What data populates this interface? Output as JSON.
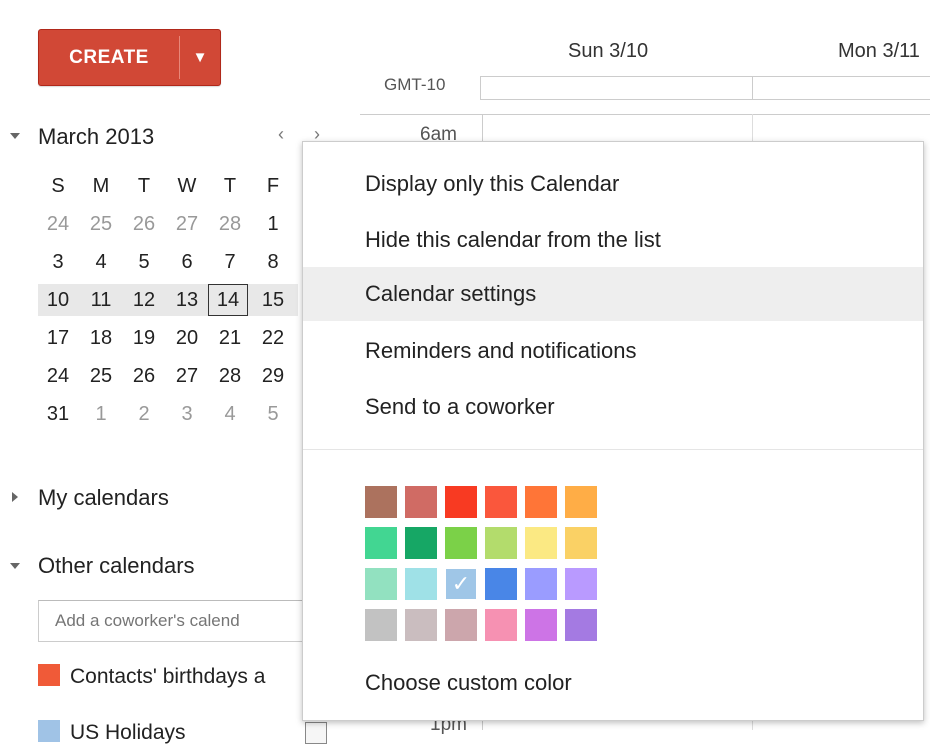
{
  "create": {
    "label": "CREATE",
    "arrow": "▼"
  },
  "grid": {
    "days": [
      "Sun 3/10",
      "Mon 3/11"
    ],
    "timezone": "GMT-10",
    "time_top": "6am",
    "time_bottom": "1pm"
  },
  "mini_calendar": {
    "title": "March 2013",
    "prev": "‹",
    "next": "›",
    "weekdays": [
      "S",
      "M",
      "T",
      "W",
      "T",
      "F"
    ],
    "weeks": [
      [
        "24",
        "25",
        "26",
        "27",
        "28",
        "1"
      ],
      [
        "3",
        "4",
        "5",
        "6",
        "7",
        "8"
      ],
      [
        "10",
        "11",
        "12",
        "13",
        "14",
        "15"
      ],
      [
        "17",
        "18",
        "19",
        "20",
        "21",
        "22"
      ],
      [
        "24",
        "25",
        "26",
        "27",
        "28",
        "29"
      ],
      [
        "31",
        "1",
        "2",
        "3",
        "4",
        "5"
      ]
    ]
  },
  "sidebar": {
    "my_calendars": "My calendars",
    "other_calendars": "Other calendars",
    "add_placeholder": "Add a coworker's calend",
    "items": [
      {
        "label": "Contacts' birthdays a",
        "color": "#f05a38"
      },
      {
        "label": "US Holidays",
        "color": "#a0c3e6"
      }
    ]
  },
  "menu": {
    "items": [
      "Display only this Calendar",
      "Hide this calendar from the list",
      "Calendar settings",
      "Reminders and notifications",
      "Send to a coworker"
    ],
    "hovered": "Calendar settings",
    "colors": [
      [
        "#ac725e",
        "#d06b64",
        "#f83a22",
        "#fa573c",
        "#ff7537",
        "#ffad46"
      ],
      [
        "#42d692",
        "#16a765",
        "#7bd148",
        "#b3dc6c",
        "#fbe983",
        "#fad165"
      ],
      [
        "#92e1c0",
        "#9fe1e7",
        "#9fc6e7",
        "#4986e7",
        "#9a9cff",
        "#b99aff"
      ],
      [
        "#c2c2c2",
        "#cabdbf",
        "#cca6ac",
        "#f691b2",
        "#cd74e6",
        "#a47ae2"
      ]
    ],
    "selected_color": "#9fc6e7",
    "custom_color": "Choose custom color"
  }
}
